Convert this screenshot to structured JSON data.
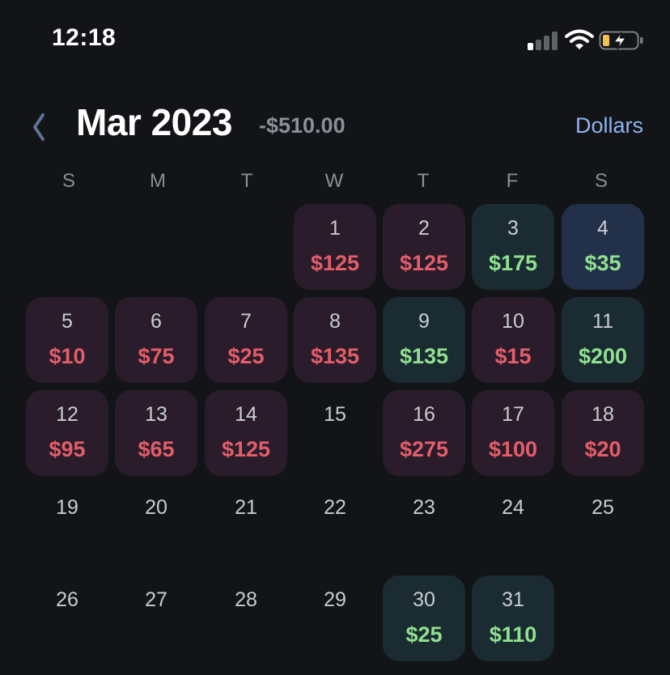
{
  "status_bar": {
    "time": "12:18",
    "signal_icon": "cellular-signal-icon",
    "wifi_icon": "wifi-icon",
    "battery_icon": "battery-charging-icon",
    "signal_bars_active": 1,
    "battery_level": 0.2
  },
  "header": {
    "back_icon": "chevron-left-icon",
    "month": "Mar 2023",
    "total": "-$510.00",
    "unit_toggle": "Dollars"
  },
  "weekdays": [
    "S",
    "M",
    "T",
    "W",
    "T",
    "F",
    "S"
  ],
  "colors": {
    "background": "#121417",
    "negative": "#e35d6a",
    "positive": "#8fe08f",
    "negative_tile": "#2a1c2a",
    "positive_tile": "#1a2c31",
    "positive_tile_alt": "#23304a",
    "accent": "#8fb4f2"
  },
  "days": [
    {
      "day": "1",
      "amount": "$125",
      "type": "neg"
    },
    {
      "day": "2",
      "amount": "$125",
      "type": "neg"
    },
    {
      "day": "3",
      "amount": "$175",
      "type": "pos"
    },
    {
      "day": "4",
      "amount": "$35",
      "type": "pos-blue"
    },
    {
      "day": "5",
      "amount": "$10",
      "type": "neg"
    },
    {
      "day": "6",
      "amount": "$75",
      "type": "neg"
    },
    {
      "day": "7",
      "amount": "$25",
      "type": "neg"
    },
    {
      "day": "8",
      "amount": "$135",
      "type": "neg"
    },
    {
      "day": "9",
      "amount": "$135",
      "type": "pos"
    },
    {
      "day": "10",
      "amount": "$15",
      "type": "neg"
    },
    {
      "day": "11",
      "amount": "$200",
      "type": "pos"
    },
    {
      "day": "12",
      "amount": "$95",
      "type": "neg"
    },
    {
      "day": "13",
      "amount": "$65",
      "type": "neg"
    },
    {
      "day": "14",
      "amount": "$125",
      "type": "neg"
    },
    {
      "day": "15",
      "amount": "",
      "type": "none"
    },
    {
      "day": "16",
      "amount": "$275",
      "type": "neg"
    },
    {
      "day": "17",
      "amount": "$100",
      "type": "neg"
    },
    {
      "day": "18",
      "amount": "$20",
      "type": "neg"
    },
    {
      "day": "19",
      "amount": "",
      "type": "none"
    },
    {
      "day": "20",
      "amount": "",
      "type": "none"
    },
    {
      "day": "21",
      "amount": "",
      "type": "none"
    },
    {
      "day": "22",
      "amount": "",
      "type": "none"
    },
    {
      "day": "23",
      "amount": "",
      "type": "none"
    },
    {
      "day": "24",
      "amount": "",
      "type": "none"
    },
    {
      "day": "25",
      "amount": "",
      "type": "none"
    },
    {
      "day": "26",
      "amount": "",
      "type": "none"
    },
    {
      "day": "27",
      "amount": "",
      "type": "none"
    },
    {
      "day": "28",
      "amount": "",
      "type": "none"
    },
    {
      "day": "29",
      "amount": "",
      "type": "none"
    },
    {
      "day": "30",
      "amount": "$25",
      "type": "pos"
    },
    {
      "day": "31",
      "amount": "$110",
      "type": "pos"
    }
  ]
}
